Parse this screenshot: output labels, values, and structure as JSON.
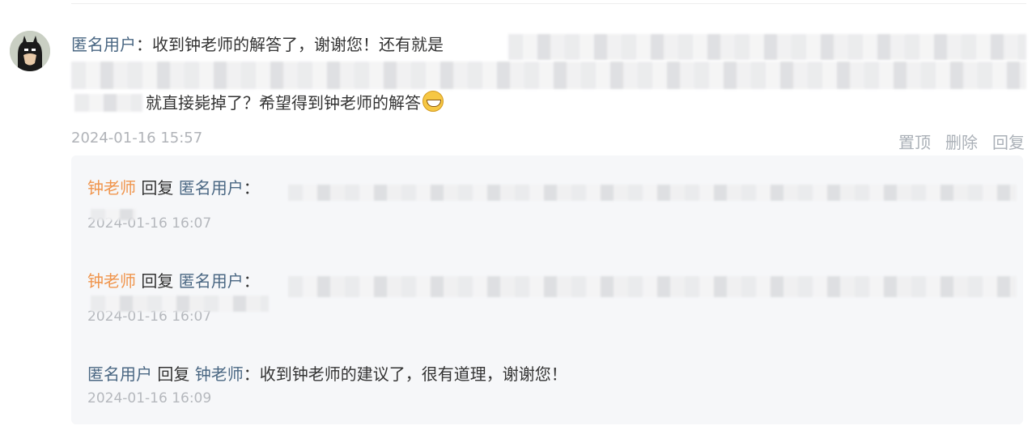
{
  "comment": {
    "author": "匿名用户",
    "colon": "：",
    "text_start": "收到钟老师的解答了，谢谢您！还有就是",
    "text_end": "就直接毙掉了？希望得到钟老师的解答",
    "timestamp": "2024-01-16 15:57",
    "actions": {
      "pin": "置顶",
      "delete": "删除",
      "reply": "回复"
    }
  },
  "replies": [
    {
      "from": "钟老师",
      "verb": "回复",
      "to": "匿名用户",
      "colon": "：",
      "text": "",
      "timestamp": "2024-01-16 16:07"
    },
    {
      "from": "钟老师",
      "verb": "回复",
      "to": "匿名用户",
      "colon": "：",
      "text": "",
      "timestamp": "2024-01-16 16:07"
    },
    {
      "from": "匿名用户",
      "verb": "回复",
      "to": "钟老师",
      "colon": "：",
      "text": "收到钟老师的建议了，很有道理，谢谢您！",
      "timestamp": "2024-01-16 16:09"
    }
  ],
  "colors": {
    "user_link": "#4a6783",
    "teacher_link": "#f0954d",
    "meta": "#b0b3b8",
    "reply_bg": "#f6f7f9"
  }
}
